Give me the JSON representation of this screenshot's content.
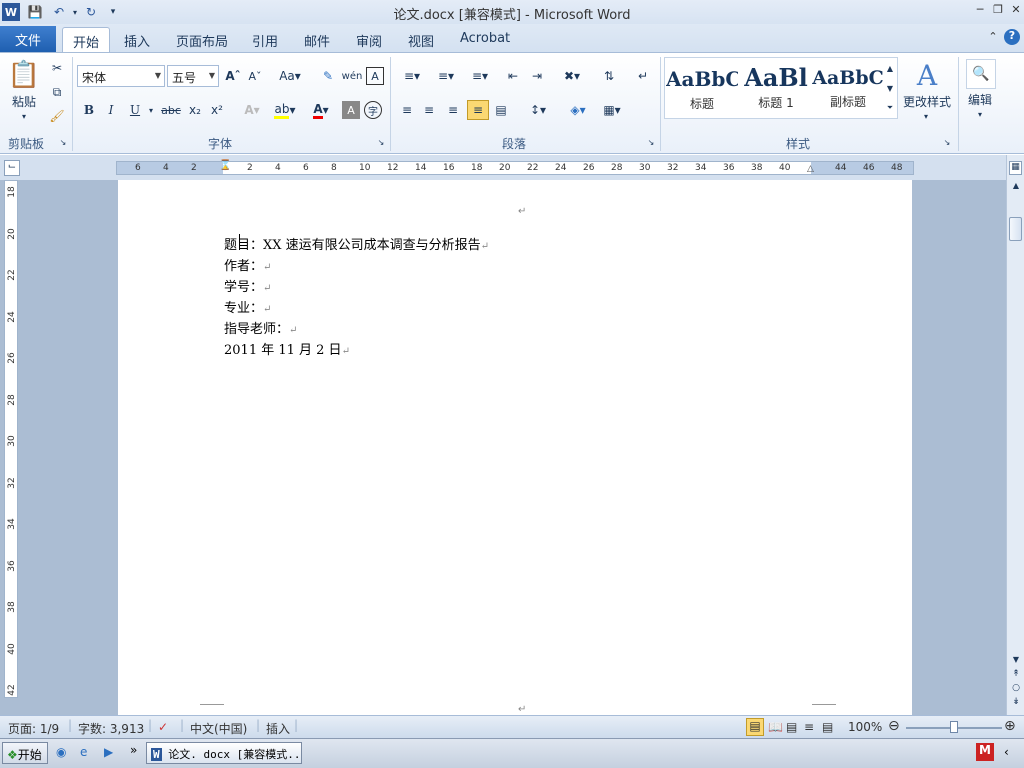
{
  "window": {
    "title": "论文.docx [兼容模式] - Microsoft Word"
  },
  "tabs": [
    {
      "label": "文件"
    },
    {
      "label": "开始"
    },
    {
      "label": "插入"
    },
    {
      "label": "页面布局"
    },
    {
      "label": "引用"
    },
    {
      "label": "邮件"
    },
    {
      "label": "审阅"
    },
    {
      "label": "视图"
    },
    {
      "label": "Acrobat"
    }
  ],
  "ribbon": {
    "clipboard": {
      "paste_label": "粘贴",
      "group_label": "剪贴板"
    },
    "font": {
      "font_name": "宋体",
      "font_size": "五号",
      "group_label": "字体"
    },
    "paragraph": {
      "group_label": "段落"
    },
    "styles": {
      "group_label": "样式",
      "items": [
        {
          "sample": "AaBbC",
          "name": "标题"
        },
        {
          "sample": "AaBl",
          "name": "标题 1"
        },
        {
          "sample": "AaBbC",
          "name": "副标题"
        }
      ],
      "change_styles_label": "更改样式"
    },
    "editing": {
      "label": "编辑"
    }
  },
  "ruler": {
    "h_ticks": [
      "6",
      "4",
      "2",
      "2",
      "4",
      "6",
      "8",
      "10",
      "12",
      "14",
      "16",
      "18",
      "20",
      "22",
      "24",
      "26",
      "28",
      "30",
      "32",
      "34",
      "36",
      "38",
      "40",
      "44",
      "46",
      "48"
    ],
    "v_ticks": [
      "18",
      "20",
      "22",
      "24",
      "26",
      "28",
      "30",
      "32",
      "34",
      "36",
      "38",
      "40",
      "42"
    ]
  },
  "document": {
    "lines": [
      "题目：XX 速运有限公司成本调查与分析报告",
      "作者：",
      "学号：",
      "专业：",
      "指导老师：",
      "2011 年 11 月 2 日"
    ]
  },
  "status": {
    "page": "页面: 1/9",
    "words": "字数: 3,913",
    "language": "中文(中国)",
    "mode": "插入",
    "zoom": "100%"
  },
  "taskbar": {
    "start_label": "开始",
    "task_label": "论文. docx [兼容模式..."
  }
}
